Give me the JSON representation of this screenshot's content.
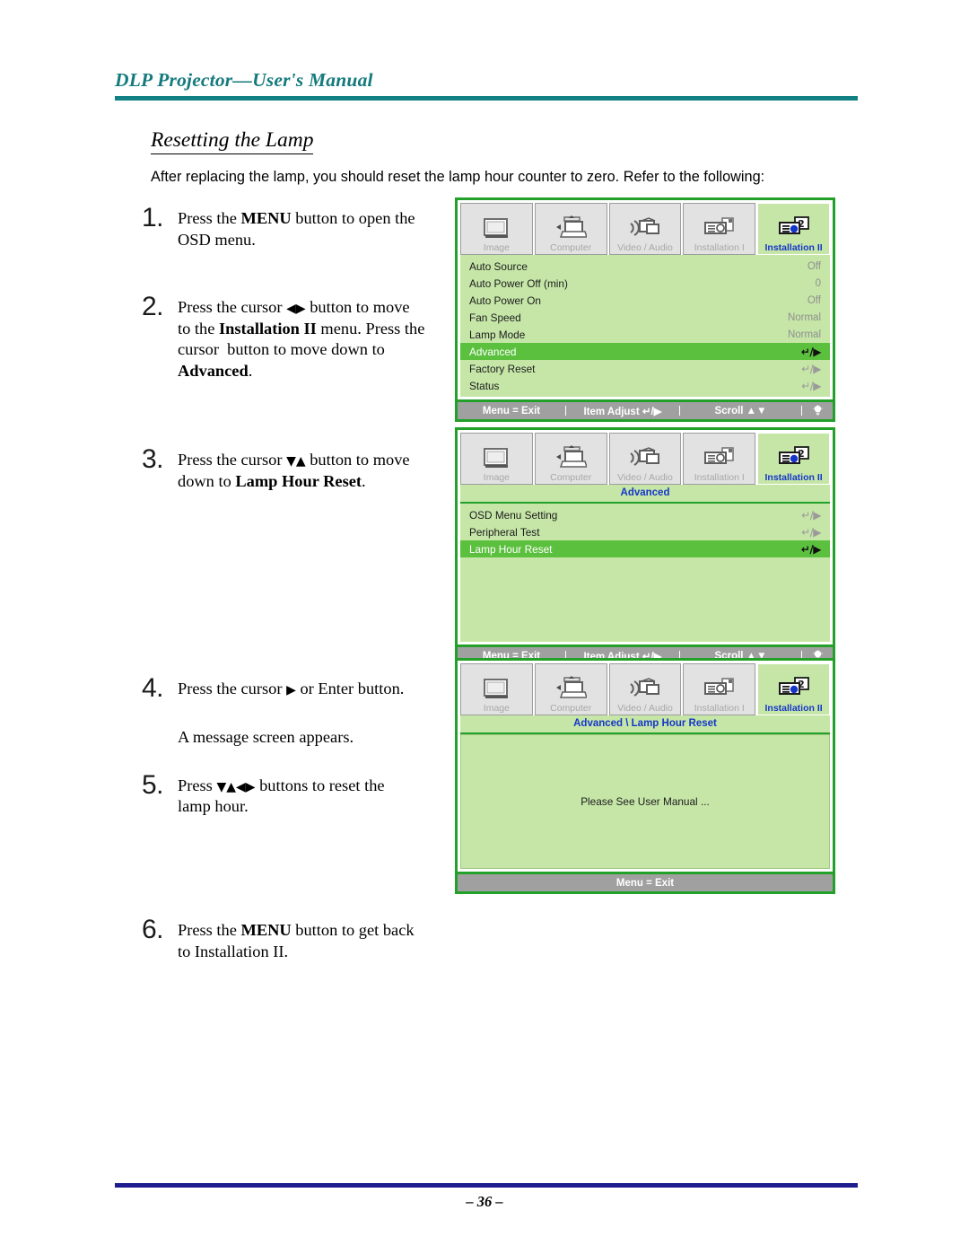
{
  "header": {
    "title": "DLP Projector—User's Manual",
    "rule_color": "#128184"
  },
  "section": {
    "heading": "Resetting the Lamp",
    "intro": "After replacing the lamp, you should reset the lamp hour counter to zero. Refer to the following:"
  },
  "steps": [
    {
      "number": "1.",
      "text_parts": [
        "Press the ",
        "MENU",
        " button to open the OSD menu."
      ],
      "plain": "Press the MENU button to open the OSD menu."
    },
    {
      "number": "2.",
      "plain": "Press the cursor ◀▶ button to move to the Installation II menu. Press the cursor button to move down to Advanced."
    },
    {
      "number": "3.",
      "plain": "Press the cursor ▼▲ button to move down to Lamp Hour Reset."
    },
    {
      "number": "4.",
      "plain": "Press the cursor ▶ or Enter button."
    },
    {
      "number": "",
      "plain": "A message screen appears."
    },
    {
      "number": "5.",
      "plain": "Press ▼▲◀▶ buttons to reset the lamp hour."
    },
    {
      "number": "6.",
      "plain": "Press the MENU button to get back to Installation II."
    }
  ],
  "osd_tabs": [
    {
      "label": "Image",
      "icon": "image-icon",
      "active": false
    },
    {
      "label": "Computer",
      "icon": "computer-icon",
      "active": false
    },
    {
      "label": "Video / Audio",
      "icon": "video-audio-icon",
      "active": false
    },
    {
      "label": "Installation I",
      "icon": "installation-one-icon",
      "active": false
    },
    {
      "label": "Installation II",
      "icon": "installation-two-icon",
      "active": true
    }
  ],
  "osd_screens": [
    {
      "id": "installation-ii-menu",
      "breadcrumb": null,
      "rows": [
        {
          "label": "Auto Source",
          "value": "Off",
          "arrows": null,
          "selected": false
        },
        {
          "label": "Auto Power Off (min)",
          "value": "0",
          "arrows": null,
          "selected": false
        },
        {
          "label": "Auto Power On",
          "value": "Off",
          "arrows": null,
          "selected": false
        },
        {
          "label": "Fan Speed",
          "value": "Normal",
          "arrows": null,
          "selected": false
        },
        {
          "label": "Lamp Mode",
          "value": "Normal",
          "arrows": null,
          "selected": false
        },
        {
          "label": "Advanced",
          "value": null,
          "arrows": "↵/▶",
          "selected": true
        },
        {
          "label": "Factory Reset",
          "value": null,
          "arrows": "↵/▶",
          "selected": false
        },
        {
          "label": "Status",
          "value": null,
          "arrows": "↵/▶",
          "selected": false
        }
      ],
      "statusbar": {
        "type": "full",
        "exit": "Menu = Exit",
        "adjust": "Item Adjust ↵/▶",
        "scroll": "Scroll ▲▼",
        "lamp_icon": "lamp-icon"
      }
    },
    {
      "id": "advanced-menu",
      "breadcrumb": "Advanced",
      "rows": [
        {
          "label": "OSD Menu Setting",
          "value": null,
          "arrows": "↵/▶",
          "selected": false
        },
        {
          "label": "Peripheral Test",
          "value": null,
          "arrows": "↵/▶",
          "selected": false
        },
        {
          "label": "Lamp Hour Reset",
          "value": null,
          "arrows": "↵/▶",
          "selected": true
        }
      ],
      "statusbar": {
        "type": "full",
        "exit": "Menu = Exit",
        "adjust": "Item Adjust ↵/▶",
        "scroll": "Scroll ▲▼",
        "lamp_icon": "lamp-icon"
      }
    },
    {
      "id": "lamp-hour-reset-message",
      "breadcrumb": "Advanced \\ Lamp Hour Reset",
      "message": "Please See User Manual ...",
      "statusbar": {
        "type": "single",
        "exit": "Menu = Exit"
      }
    }
  ],
  "footer": {
    "page_number": "– 36 –",
    "rule_color": "#1d1d8f"
  },
  "colors": {
    "teal": "#128184",
    "osd_green_bg": "#c6e6a8",
    "osd_green_border": "#22a02a",
    "osd_highlight": "#5cc03f",
    "osd_blue_text": "#1536c8",
    "osd_statusbar": "#a0a0a0"
  }
}
